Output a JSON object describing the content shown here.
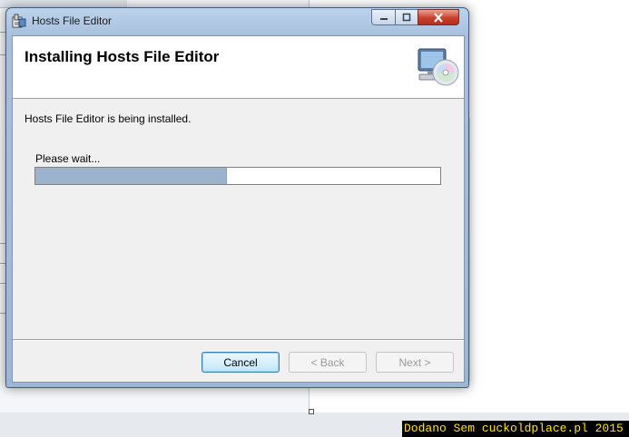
{
  "window": {
    "title": "Hosts File Editor",
    "icon": "installer-app-icon",
    "controls": {
      "minimize": "minimize-icon",
      "maximize": "maximize-icon",
      "close": "close-icon"
    }
  },
  "header": {
    "title": "Installing Hosts File Editor",
    "icon": "computer-disc-icon"
  },
  "body": {
    "status": "Hosts File Editor is being installed.",
    "wait_label": "Please wait...",
    "progress_fraction": 0.47
  },
  "buttons": {
    "cancel": "Cancel",
    "back": "< Back",
    "next": "Next >"
  },
  "watermark": "Dodano Sem cuckoldplace.pl 2015",
  "colors": {
    "progress_fill": "#9db2cc",
    "watermark_bg": "#000000",
    "watermark_text": "#ffe400",
    "close_button": "#c8412c"
  }
}
